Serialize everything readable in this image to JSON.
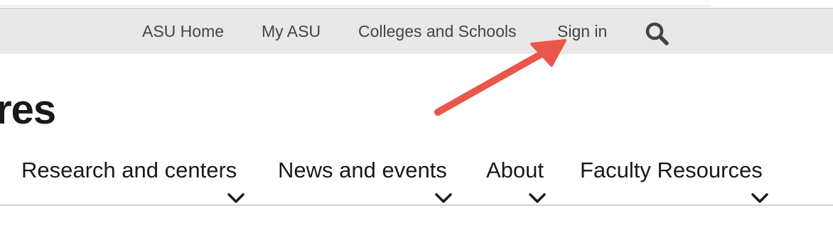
{
  "universal_nav": {
    "links": [
      "ASU Home",
      "My ASU",
      "Colleges and Schools",
      "Sign in"
    ],
    "search_icon": "search-icon"
  },
  "site": {
    "title_fragment": "res"
  },
  "main_nav": {
    "items": [
      {
        "label": "Research and centers",
        "icon": "chevron-down-icon"
      },
      {
        "label": "News and events",
        "icon": "chevron-down-icon"
      },
      {
        "label": "About",
        "icon": "chevron-down-icon"
      },
      {
        "label": "Faculty Resources",
        "icon": "chevron-down-icon"
      }
    ]
  },
  "annotation": {
    "arrow_color": "#e8574a",
    "arrow_target": "Sign in"
  },
  "colors": {
    "universal_bar_bg": "#e8e8e8",
    "text_dark": "#191919",
    "text_muted": "#444444"
  }
}
